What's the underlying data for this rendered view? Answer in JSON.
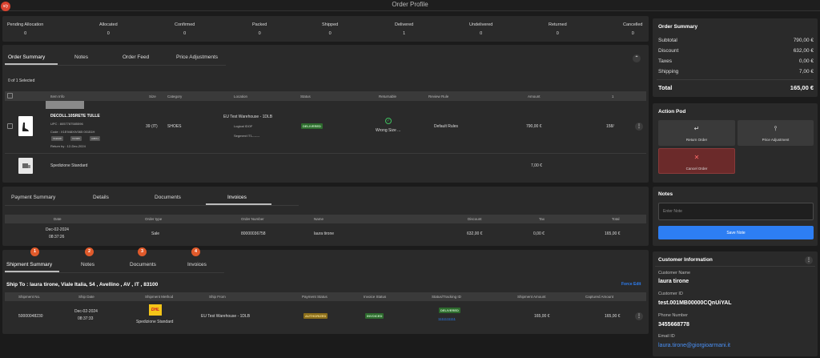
{
  "window": {
    "title": "Order Profile",
    "avatar": "x/y"
  },
  "status_bar": [
    {
      "label": "Pending Allocation",
      "value": "0"
    },
    {
      "label": "Allocated",
      "value": "0"
    },
    {
      "label": "Confirmed",
      "value": "0"
    },
    {
      "label": "Packed",
      "value": "0"
    },
    {
      "label": "Shipped",
      "value": "0"
    },
    {
      "label": "Delivered",
      "value": "1"
    },
    {
      "label": "Undelivered",
      "value": "0"
    },
    {
      "label": "Returned",
      "value": "0"
    },
    {
      "label": "Cancelled",
      "value": "0"
    }
  ],
  "order_tabs": [
    "Order Summary",
    "Notes",
    "Order Feed",
    "Price Adjustments"
  ],
  "selected_text": "0 of 1 Selected",
  "items_table": {
    "headers": [
      "Item Info",
      "Size",
      "Category",
      "Location",
      "Status",
      "Returnable",
      "Review Rule",
      "Amount",
      "1"
    ],
    "row": {
      "name": "DECOLL.10SRETE TULLE",
      "upc": "UPC : 8057787585596",
      "code": "Code : X1E948XIV065 00151H",
      "chips": [
        "X1E948",
        "XIV065",
        "A08X1"
      ],
      "return_by": "Return by : 12-Dec-2024",
      "size": "39 (IT)",
      "category": "SHOES",
      "location": "EU Test Warehouse - 1DLB",
      "logical": "Logical IDOF",
      "segment": "Segment IT1-------",
      "status": "DELIVERED",
      "returnable": "Wrong Size ...",
      "review_rule": "Default Rules",
      "amount": "790,00 €",
      "qty": "158/"
    },
    "shipping_row": {
      "name": "Spedizione Standard",
      "amount": "7,00 €"
    }
  },
  "payment_tabs": [
    "Payment Summary",
    "Details",
    "Documents",
    "Invoices"
  ],
  "invoices_table": {
    "headers": [
      "Date",
      "Order type",
      "Order Number",
      "Name",
      "Discount",
      "Tax",
      "Total"
    ],
    "row": {
      "date": "Dec-02-2024",
      "time": "08:37:26",
      "order_type": "Sale",
      "order_number": "80000036758",
      "name": "laura tirone",
      "discount": "632,00 €",
      "tax": "0,00 €",
      "total": "165,00 €"
    }
  },
  "shipment_tabs": [
    {
      "num": "1",
      "label": "Shipment Summary"
    },
    {
      "num": "2",
      "label": "Notes"
    },
    {
      "num": "3",
      "label": "Documents"
    },
    {
      "num": "4",
      "label": "Invoices"
    }
  ],
  "ship_to": "Ship To : laura tirone, Viale Italia, 54 , Avellino , AV , IT , 83100",
  "force_edit": "Force Edit",
  "shipment_table": {
    "headers": [
      "Shipment No.",
      "Ship Date",
      "Shipment Method",
      "Ship From",
      "Payment Status",
      "Invoice Status",
      "Status/Tracking ID",
      "Shipment Amount",
      "Captured Amount"
    ],
    "row": {
      "shipment_no": "50000048230",
      "date": "Dec-02-2024",
      "time": "08:37:33",
      "carrier": "DHL",
      "method": "Spedizione Standard",
      "ship_from": "EU Test Warehouse - 1DLB",
      "payment_status": "AUTHORIZED",
      "invoice_status": "INVOICED",
      "status": "DELIVERED",
      "tracking": "1111111111",
      "shipment_amount": "165,00 €",
      "captured_amount": "165,00 €"
    }
  },
  "summary": {
    "title": "Order Summary",
    "rows": [
      {
        "label": "Subtotal",
        "value": "790,00 €"
      },
      {
        "label": "Discount",
        "value": "632,00 €"
      },
      {
        "label": "Taxes",
        "value": "0,00 €"
      },
      {
        "label": "Shipping",
        "value": "7,00 €"
      }
    ],
    "total_label": "Total",
    "total_value": "165,00 €"
  },
  "action_pod": {
    "title": "Action Pod",
    "return_order": "Return Order",
    "price_adjustment": "Price Adjustment",
    "cancel_order": "Cancel Order"
  },
  "notes": {
    "title": "Notes",
    "placeholder": "Enter Note",
    "save": "Save Note"
  },
  "customer": {
    "title": "Customer Information",
    "name_label": "Customer Name",
    "name": "laura tirone",
    "id_label": "Customer ID",
    "id": "test.001MB00000CQnUiYAL",
    "phone_label": "Phone Number",
    "phone": "3455668778",
    "email_label": "Email ID",
    "email": "laura.tirone@giorgioarmani.it"
  },
  "colors": {
    "accent": "#2d7ef3",
    "delivered": "#2e6b2e",
    "authorized": "#8a6d1a",
    "cancel": "#6b2a2a",
    "step_badge": "#e05a2b"
  }
}
